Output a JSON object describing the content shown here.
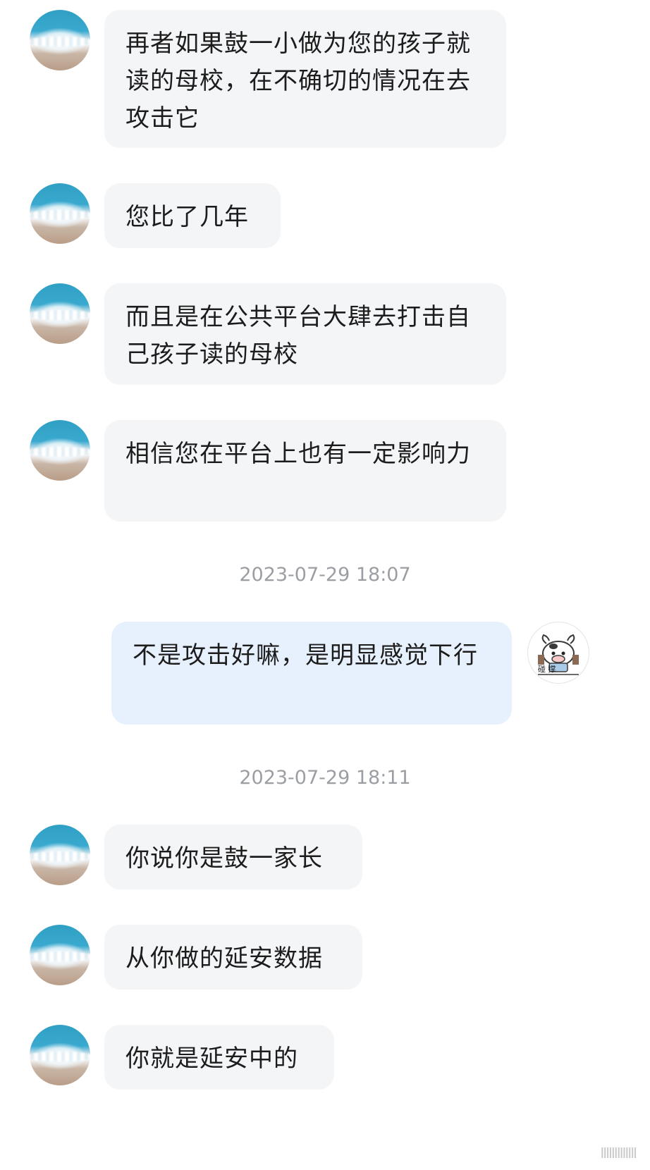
{
  "messages": [
    {
      "text": "再者如果鼓一小做为您的孩子就读的母校，在不确切的情况在去攻击它"
    },
    {
      "text": "您比了几年"
    },
    {
      "text": "而且是在公共平台大肆去打击自己孩子读的母校"
    },
    {
      "text": "相信您在平台上也有一定影响力"
    },
    {
      "timestamp": "2023-07-29 18:07"
    },
    {
      "text": "不是攻击好嘛，是明显感觉下行"
    },
    {
      "timestamp": "2023-07-29 18:11"
    },
    {
      "text": "你说你是鼓一家长"
    },
    {
      "text": "从你做的延安数据"
    },
    {
      "text": "你就是延安中的"
    }
  ],
  "self_avatar": {
    "text": "碰 撑"
  },
  "watermark": {
    "text": "IIIIIIIIIIIII"
  },
  "colors": {
    "incoming_bubble": "#f4f5f7",
    "outgoing_bubble": "#e7f1fd",
    "timestamp": "#9b9ea3"
  }
}
